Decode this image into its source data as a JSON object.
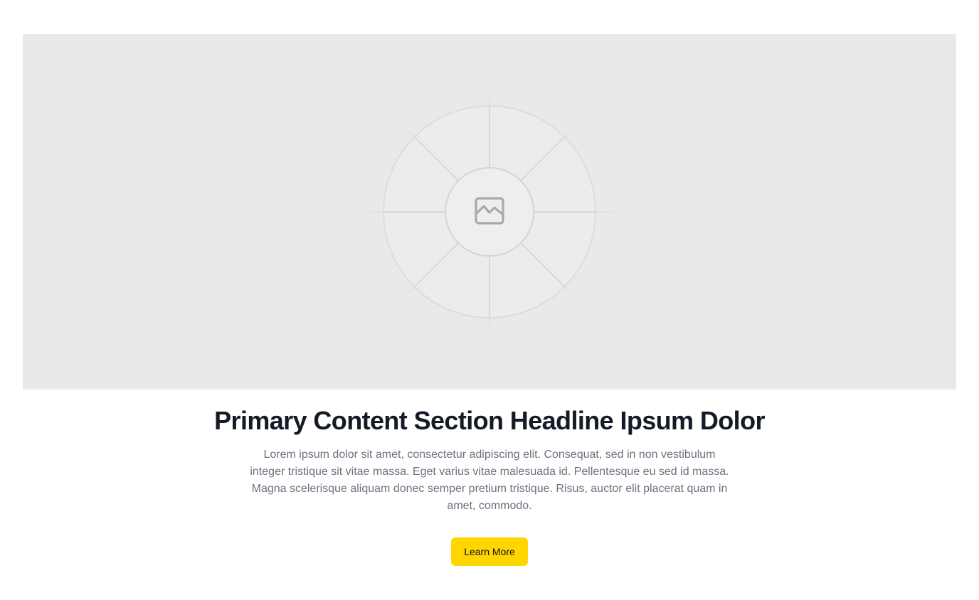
{
  "hero": {
    "image_icon": "image-placeholder-icon"
  },
  "content": {
    "headline": "Primary Content Section Headline Ipsum Dolor",
    "body": "Lorem ipsum dolor sit amet, consectetur adipiscing elit. Consequat, sed in non vestibulum integer tristique sit vitae massa. Eget varius vitae malesuada id. Pellentesque eu sed id massa. Magna scelerisque aliquam donec semper pretium tristique. Risus, auctor elit placerat quam in amet, commodo.",
    "cta_label": "Learn More"
  },
  "colors": {
    "accent": "#ffd600",
    "headline": "#141a26",
    "body_text": "#6b7280",
    "placeholder_bg": "#e9e9e9"
  }
}
